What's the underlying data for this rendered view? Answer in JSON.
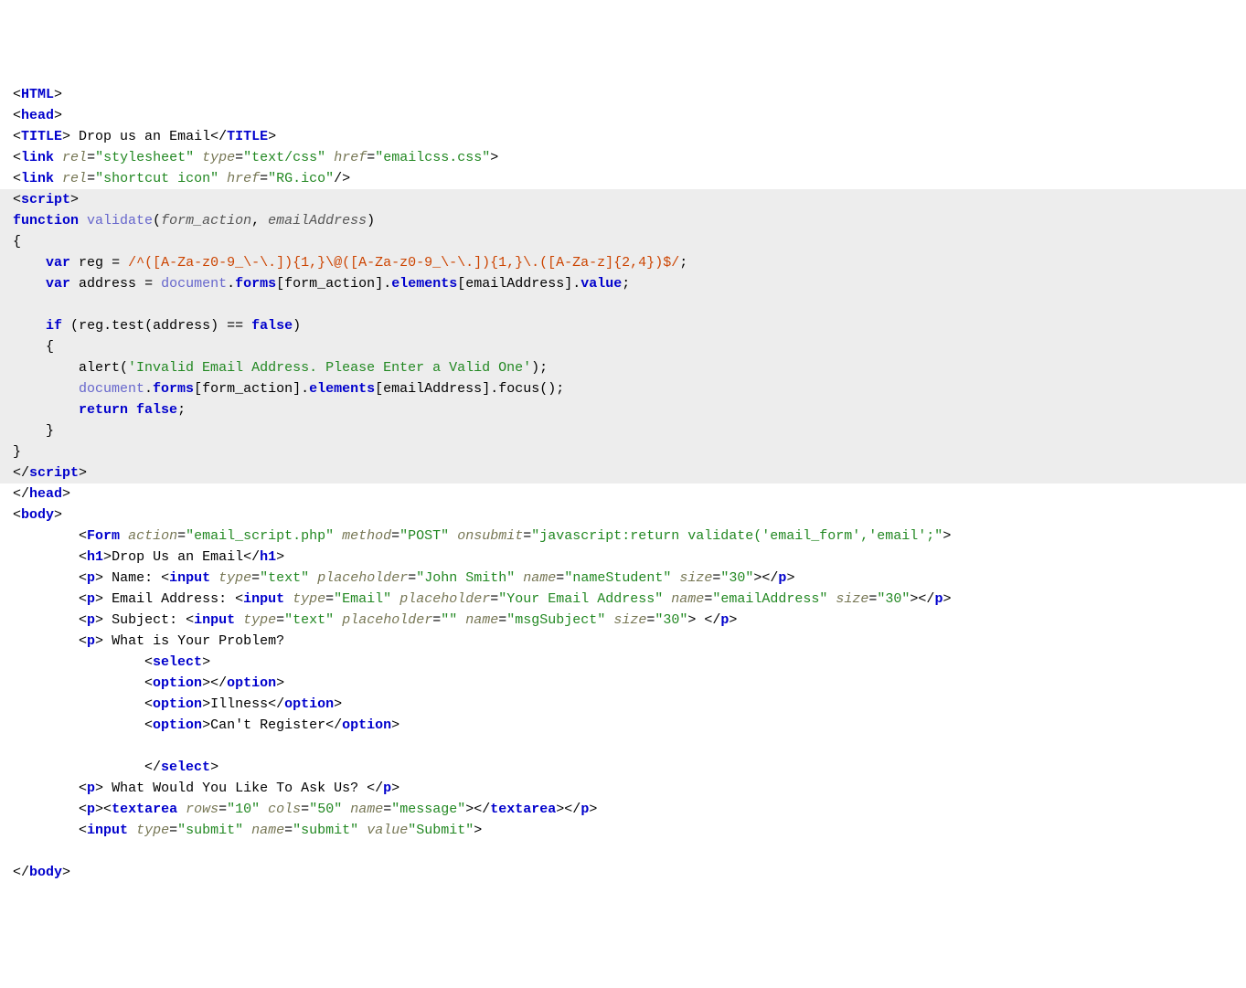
{
  "l1_html": "HTML",
  "l2_head": "head",
  "l3_title_open": "TITLE",
  "l3_title_text": " Drop us an Email",
  "l3_title_close": "TITLE",
  "l4_link": "link",
  "l4_rel_k": "rel",
  "l4_rel_v": "\"stylesheet\"",
  "l4_type_k": "type",
  "l4_type_v": "\"text/css\"",
  "l4_href_k": "href",
  "l4_href_v": "\"emailcss.css\"",
  "l5_link": "link",
  "l5_rel_k": "rel",
  "l5_rel_v": "\"shortcut icon\"",
  "l5_href_k": "href",
  "l5_href_v": "\"RG.ico\"",
  "l6_script": "script",
  "l7_function": "function",
  "l7_validate": "validate",
  "l7_p1": "form_action",
  "l7_p2": "emailAddress",
  "l9_var": "var",
  "l9_reg": "reg",
  "l9_regex": "/^([A-Za-z0-9_\\-\\.]){1,}\\@([A-Za-z0-9_\\-\\.]){1,}\\.([A-Za-z]{2,4})$/",
  "l10_var": "var",
  "l10_address": "address",
  "l10_document": "document",
  "l10_forms": "forms",
  "l10_formaction": "form_action",
  "l10_elements": "elements",
  "l10_emailaddr": "emailAddress",
  "l10_value": "value",
  "l12_if": "if",
  "l12_reg": "reg",
  "l12_test": "test",
  "l12_address": "address",
  "l12_false": "false",
  "l14_alert": "alert",
  "l14_str": "'Invalid Email Address. Please Enter a Valid One'",
  "l15_document": "document",
  "l15_forms": "forms",
  "l15_formaction": "form_action",
  "l15_elements": "elements",
  "l15_emailaddr": "emailAddress",
  "l15_focus": "focus",
  "l16_return": "return",
  "l16_false": "false",
  "l19_script": "script",
  "l20_head": "head",
  "l21_body": "body",
  "l22_form": "Form",
  "l22_action_k": "action",
  "l22_action_v": "\"email_script.php\"",
  "l22_method_k": "method",
  "l22_method_v": "\"POST\"",
  "l22_onsubmit_k": "onsubmit",
  "l22_onsubmit_v": "\"javascript:return validate('email_form','email';\"",
  "l23_h1": "h1",
  "l23_text": "Drop Us an Email",
  "l24_p": "p",
  "l24_label": " Name: ",
  "l24_input": "input",
  "l24_type_k": "type",
  "l24_type_v": "\"text\"",
  "l24_ph_k": "placeholder",
  "l24_ph_v": "\"John Smith\"",
  "l24_name_k": "name",
  "l24_name_v": "\"nameStudent\"",
  "l24_size_k": "size",
  "l24_size_v": "\"30\"",
  "l25_p": "p",
  "l25_label": " Email Address: ",
  "l25_input": "input",
  "l25_type_k": "type",
  "l25_type_v": "\"Email\"",
  "l25_ph_k": "placeholder",
  "l25_ph_v": "\"Your Email Address\"",
  "l25_name_k": "name",
  "l25_name_v": "\"emailAddress\"",
  "l25_size_k": "size",
  "l25_size_v": "\"30\"",
  "l26_p": "p",
  "l26_label": " Subject: ",
  "l26_input": "input",
  "l26_type_k": "type",
  "l26_type_v": "\"text\"",
  "l26_ph_k": "placeholder",
  "l26_ph_v": "\"\"",
  "l26_name_k": "name",
  "l26_name_v": "\"msgSubject\"",
  "l26_size_k": "size",
  "l26_size_v": "\"30\"",
  "l27_p": "p",
  "l27_label": " What is Your Problem?",
  "l28_select": "select",
  "l29_option": "option",
  "l30_option": "option",
  "l30_text": "Illness",
  "l31_option": "option",
  "l31_text": "Can't Register",
  "l33_select": "select",
  "l34_p": "p",
  "l34_label": " What Would You Like To Ask Us? ",
  "l35_p": "p",
  "l35_textarea": "textarea",
  "l35_rows_k": "rows",
  "l35_rows_v": "\"10\"",
  "l35_cols_k": "cols",
  "l35_cols_v": "\"50\"",
  "l35_name_k": "name",
  "l35_name_v": "\"message\"",
  "l36_input": "input",
  "l36_type_k": "type",
  "l36_type_v": "\"submit\"",
  "l36_name_k": "name",
  "l36_name_v": "\"submit\"",
  "l36_value_k": "value",
  "l36_value_v": "\"Submit\"",
  "l38_body": "body"
}
